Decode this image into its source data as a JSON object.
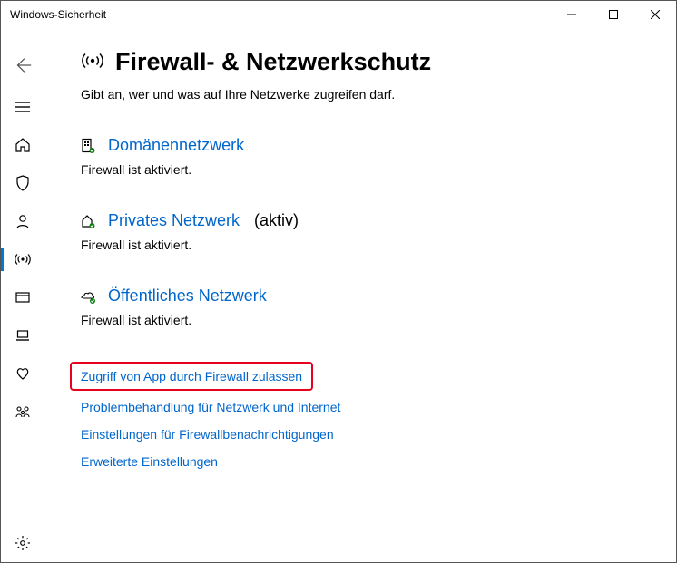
{
  "window": {
    "title": "Windows-Sicherheit"
  },
  "page": {
    "title": "Firewall- & Netzwerkschutz",
    "description": "Gibt an, wer und was auf Ihre Netzwerke zugreifen darf."
  },
  "networks": {
    "domain": {
      "label": "Domänennetzwerk",
      "status": "Firewall ist aktiviert.",
      "active_suffix": ""
    },
    "private": {
      "label": "Privates Netzwerk",
      "status": "Firewall ist aktiviert.",
      "active_suffix": "(aktiv)"
    },
    "public": {
      "label": "Öffentliches Netzwerk",
      "status": "Firewall ist aktiviert.",
      "active_suffix": ""
    }
  },
  "links": {
    "allow_app": "Zugriff von App durch Firewall zulassen",
    "troubleshoot": "Problembehandlung für Netzwerk und Internet",
    "notifications": "Einstellungen für Firewallbenachrichtigungen",
    "advanced": "Erweiterte Einstellungen"
  }
}
